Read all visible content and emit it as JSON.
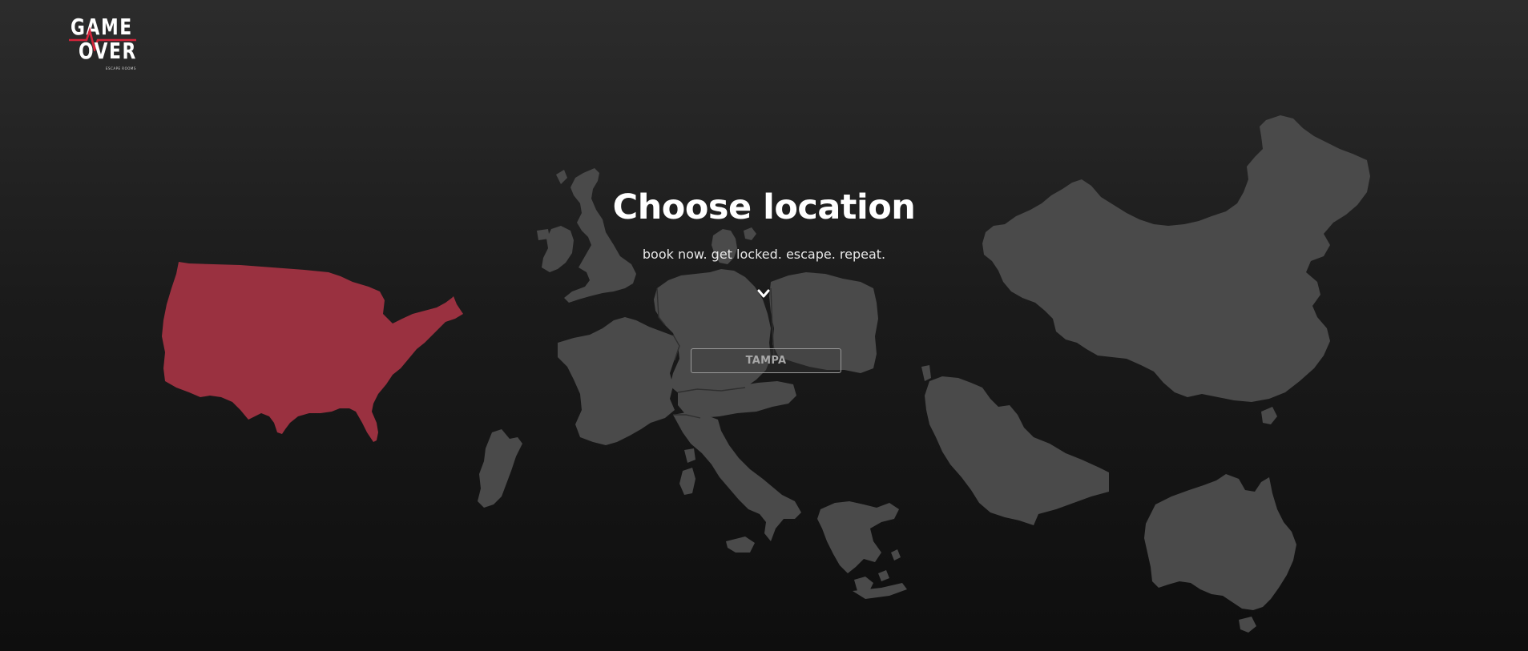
{
  "brand": {
    "logo_line_1": "GAME",
    "logo_line_2": "OVER",
    "logo_tagline": "ESCAPE ROOMS",
    "accent_color": "#d4243a"
  },
  "hero": {
    "title": "Choose location",
    "subtitle": "book now. get locked. escape. repeat.",
    "scroll_icon": "chevron-down-icon"
  },
  "location_select": {
    "selected": "TAMPA"
  },
  "map": {
    "highlight_color": "#9a3140",
    "land_color": "#4a4a4a",
    "regions": [
      {
        "id": "usa",
        "active": true
      },
      {
        "id": "uk",
        "active": false
      },
      {
        "id": "france",
        "active": false
      },
      {
        "id": "germany",
        "active": false
      },
      {
        "id": "poland",
        "active": false
      },
      {
        "id": "italy",
        "active": false
      },
      {
        "id": "spain",
        "active": false
      },
      {
        "id": "greece",
        "active": false
      },
      {
        "id": "denmark",
        "active": false
      },
      {
        "id": "saudi-arabia",
        "active": false
      },
      {
        "id": "china",
        "active": false
      },
      {
        "id": "australia",
        "active": false
      }
    ]
  }
}
